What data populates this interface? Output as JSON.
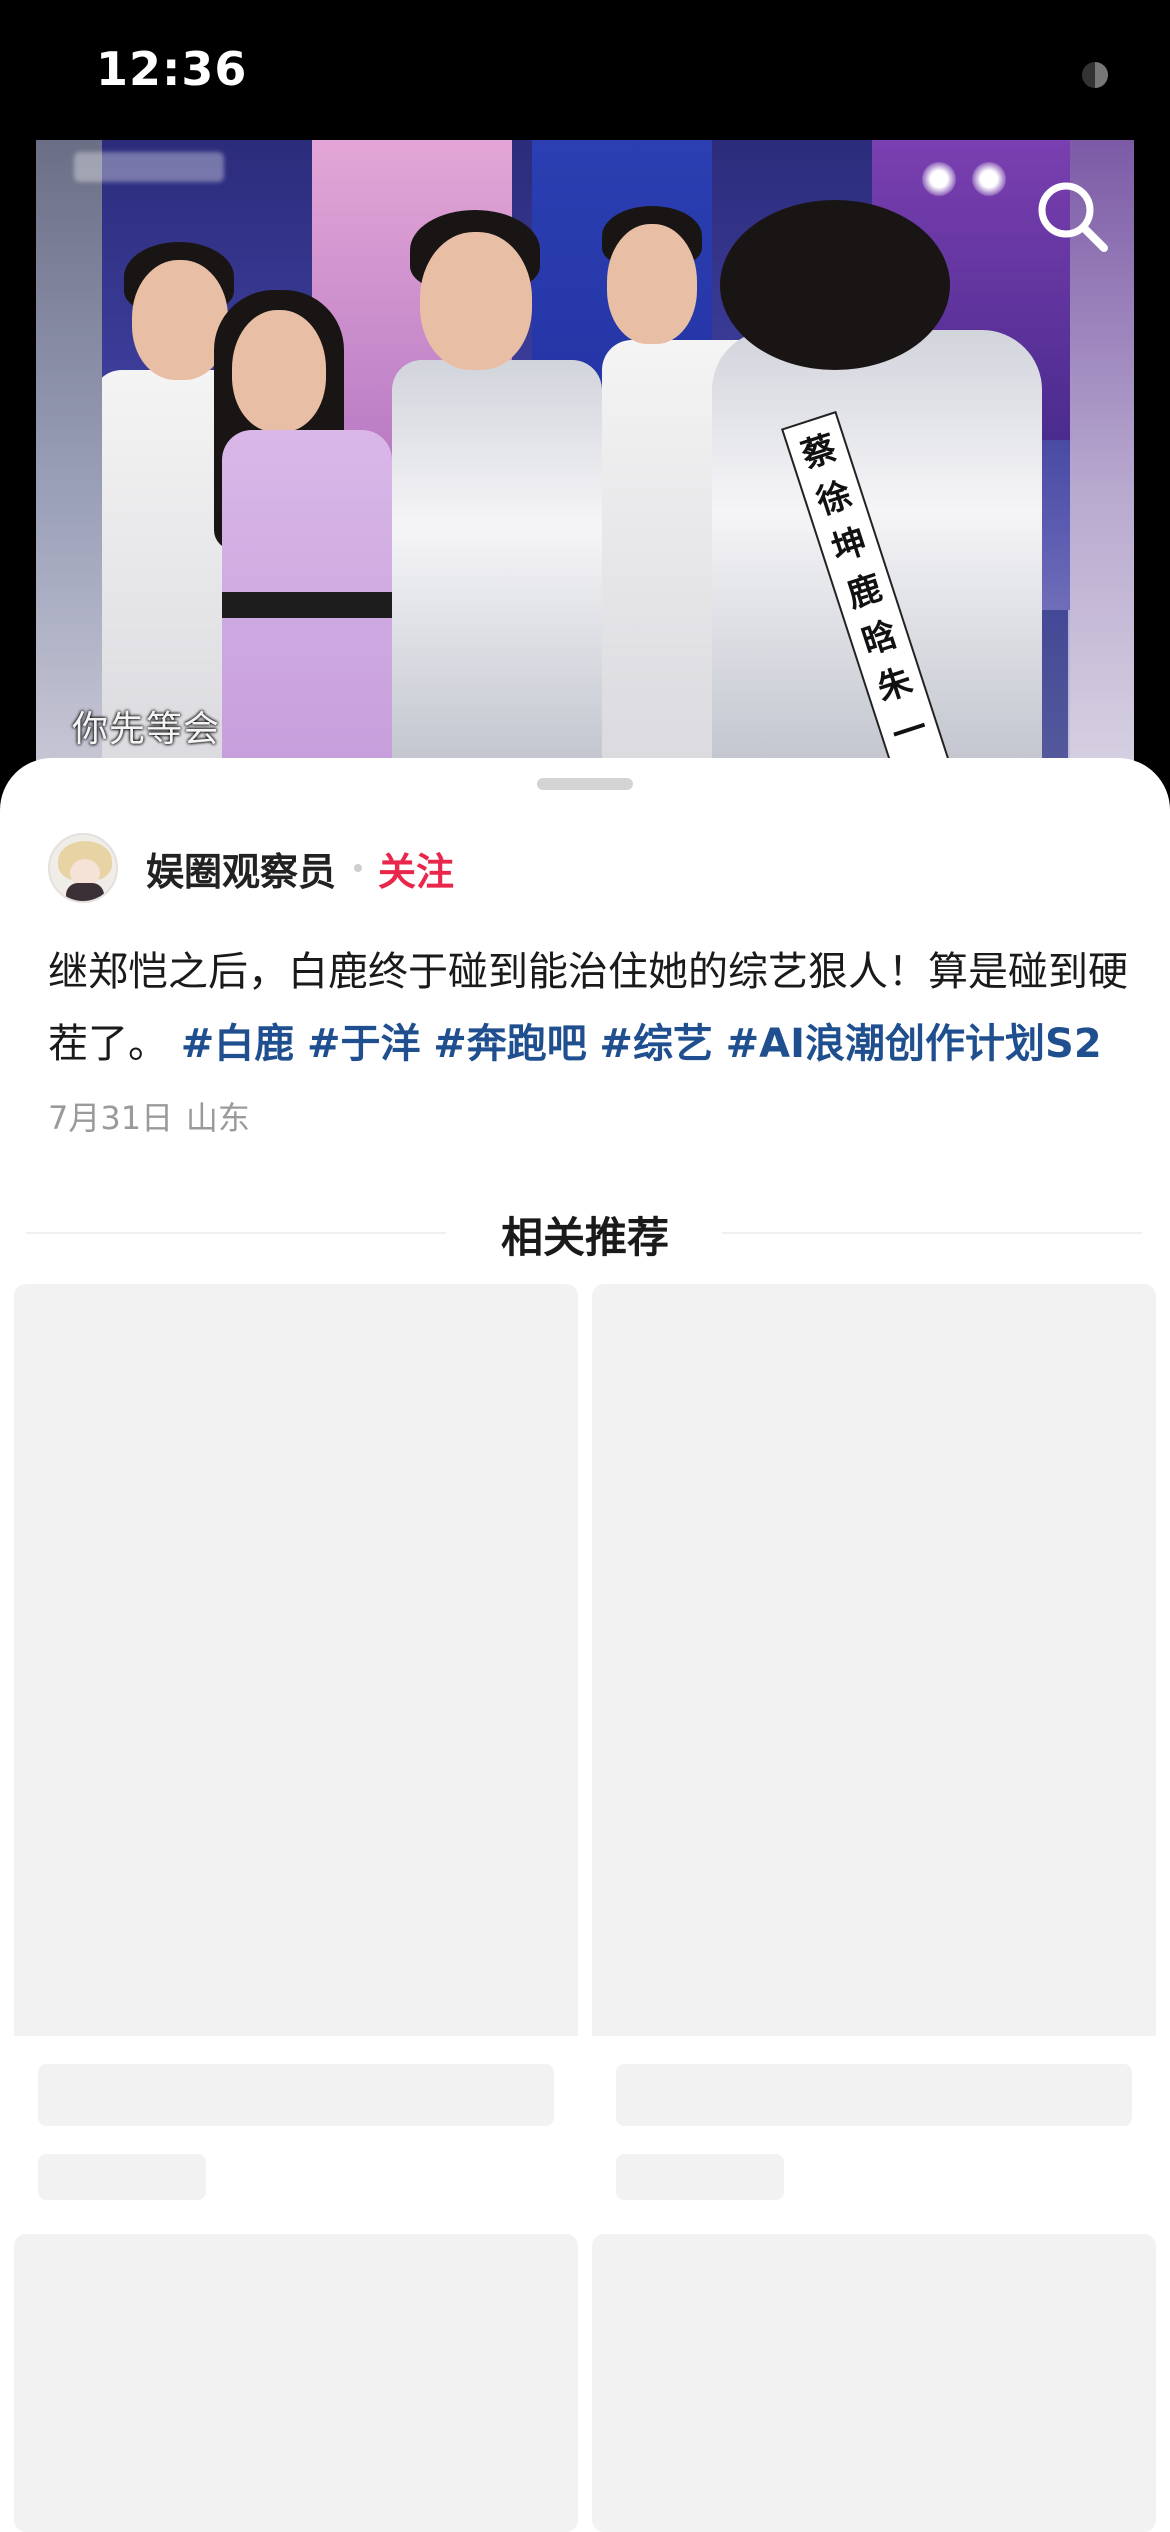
{
  "status_bar": {
    "time": "12:36"
  },
  "video": {
    "subtitle": "你先等会",
    "name_tag": "蔡徐坤 鹿晗 朱一龙",
    "search_icon": "search-icon"
  },
  "post": {
    "author_name": "娱圈观察员",
    "follow_label": "关注",
    "body_text": "继郑恺之后，白鹿终于碰到能治住她的综艺狠人！算是碰到硬茬了。",
    "tags": [
      "#白鹿",
      "#于洋",
      "#奔跑吧",
      "#综艺",
      "#AI浪潮创作计划S2"
    ],
    "date": "7月31日",
    "location": "山东"
  },
  "related": {
    "title": "相关推荐"
  },
  "colors": {
    "accent_follow": "#e8274b",
    "tag_blue": "#1f4f8e",
    "placeholder_gray": "#f2f2f2"
  }
}
